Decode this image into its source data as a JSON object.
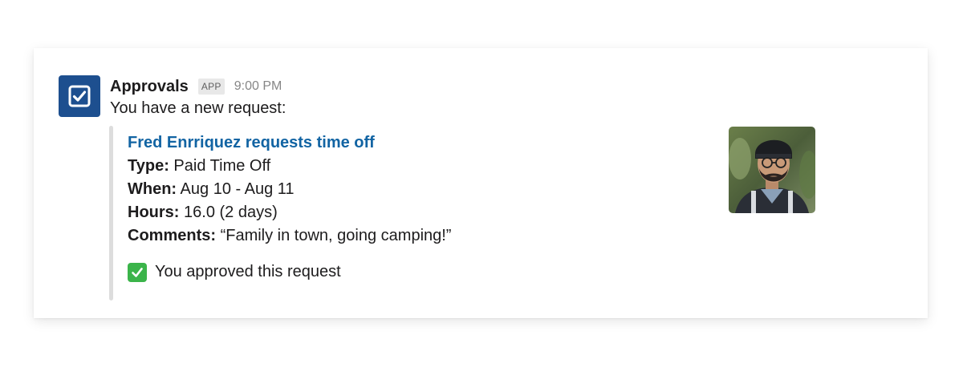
{
  "message": {
    "app_name": "Approvals",
    "app_badge": "APP",
    "timestamp": "9:00 PM",
    "intro": "You have a new request:",
    "app_icon": "checkbox-icon",
    "accent_color": "#1d4f8f"
  },
  "attachment": {
    "title": "Fred Enrriquez requests time off",
    "title_color": "#1264a3",
    "fields": [
      {
        "label": "Type:",
        "value": "Paid Time Off"
      },
      {
        "label": "When:",
        "value": "Aug 10 - Aug 11"
      },
      {
        "label": "Hours:",
        "value": "16.0 (2 days)"
      },
      {
        "label": "Comments:",
        "value": "“Family in town, going camping!”"
      }
    ],
    "status_icon": "white-check-mark-icon",
    "status_text": "You approved this request"
  }
}
